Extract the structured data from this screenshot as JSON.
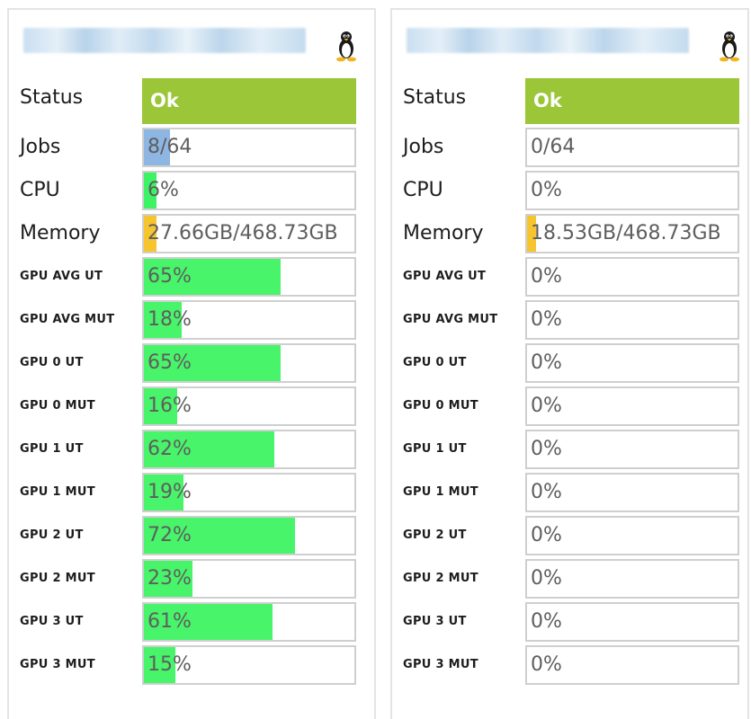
{
  "colors": {
    "status_ok": "#9ac638",
    "jobs_bar": "#8db6e2",
    "cpu_bar": "#3df264",
    "memory_bar": "#f6c42f",
    "gpu_bar": "#48f46a",
    "cell_border": "#cfcfcf"
  },
  "icons": {
    "os": "linux-tux-icon"
  },
  "panels": [
    {
      "status": "Ok",
      "metrics": [
        {
          "label": "Jobs",
          "value": "8/64",
          "level": 0.125,
          "kind": "jobs",
          "size": "large"
        },
        {
          "label": "CPU",
          "value": "6%",
          "level": 0.06,
          "kind": "cpu",
          "size": "large"
        },
        {
          "label": "Memory",
          "value": "27.66GB/468.73GB",
          "level": 0.059,
          "kind": "memory",
          "size": "large"
        },
        {
          "label": "GPU AVG UT",
          "value": "65%",
          "level": 0.65,
          "kind": "gpu",
          "size": "small"
        },
        {
          "label": "GPU AVG MUT",
          "value": "18%",
          "level": 0.18,
          "kind": "gpu",
          "size": "small"
        },
        {
          "label": "GPU 0 UT",
          "value": "65%",
          "level": 0.65,
          "kind": "gpu",
          "size": "small"
        },
        {
          "label": "GPU 0 MUT",
          "value": "16%",
          "level": 0.16,
          "kind": "gpu",
          "size": "small"
        },
        {
          "label": "GPU 1 UT",
          "value": "62%",
          "level": 0.62,
          "kind": "gpu",
          "size": "small"
        },
        {
          "label": "GPU 1 MUT",
          "value": "19%",
          "level": 0.19,
          "kind": "gpu",
          "size": "small"
        },
        {
          "label": "GPU 2 UT",
          "value": "72%",
          "level": 0.72,
          "kind": "gpu",
          "size": "small"
        },
        {
          "label": "GPU 2 MUT",
          "value": "23%",
          "level": 0.23,
          "kind": "gpu",
          "size": "small"
        },
        {
          "label": "GPU 3 UT",
          "value": "61%",
          "level": 0.61,
          "kind": "gpu",
          "size": "small"
        },
        {
          "label": "GPU 3 MUT",
          "value": "15%",
          "level": 0.15,
          "kind": "gpu",
          "size": "small"
        }
      ]
    },
    {
      "status": "Ok",
      "metrics": [
        {
          "label": "Jobs",
          "value": "0/64",
          "level": 0,
          "kind": "jobs",
          "size": "large"
        },
        {
          "label": "CPU",
          "value": "0%",
          "level": 0,
          "kind": "cpu",
          "size": "large"
        },
        {
          "label": "Memory",
          "value": "18.53GB/468.73GB",
          "level": 0.04,
          "kind": "memory",
          "size": "large"
        },
        {
          "label": "GPU AVG UT",
          "value": "0%",
          "level": 0,
          "kind": "gpu",
          "size": "small"
        },
        {
          "label": "GPU AVG MUT",
          "value": "0%",
          "level": 0,
          "kind": "gpu",
          "size": "small"
        },
        {
          "label": "GPU 0 UT",
          "value": "0%",
          "level": 0,
          "kind": "gpu",
          "size": "small"
        },
        {
          "label": "GPU 0 MUT",
          "value": "0%",
          "level": 0,
          "kind": "gpu",
          "size": "small"
        },
        {
          "label": "GPU 1 UT",
          "value": "0%",
          "level": 0,
          "kind": "gpu",
          "size": "small"
        },
        {
          "label": "GPU 1 MUT",
          "value": "0%",
          "level": 0,
          "kind": "gpu",
          "size": "small"
        },
        {
          "label": "GPU 2 UT",
          "value": "0%",
          "level": 0,
          "kind": "gpu",
          "size": "small"
        },
        {
          "label": "GPU 2 MUT",
          "value": "0%",
          "level": 0,
          "kind": "gpu",
          "size": "small"
        },
        {
          "label": "GPU 3 UT",
          "value": "0%",
          "level": 0,
          "kind": "gpu",
          "size": "small"
        },
        {
          "label": "GPU 3 MUT",
          "value": "0%",
          "level": 0,
          "kind": "gpu",
          "size": "small"
        }
      ]
    }
  ]
}
